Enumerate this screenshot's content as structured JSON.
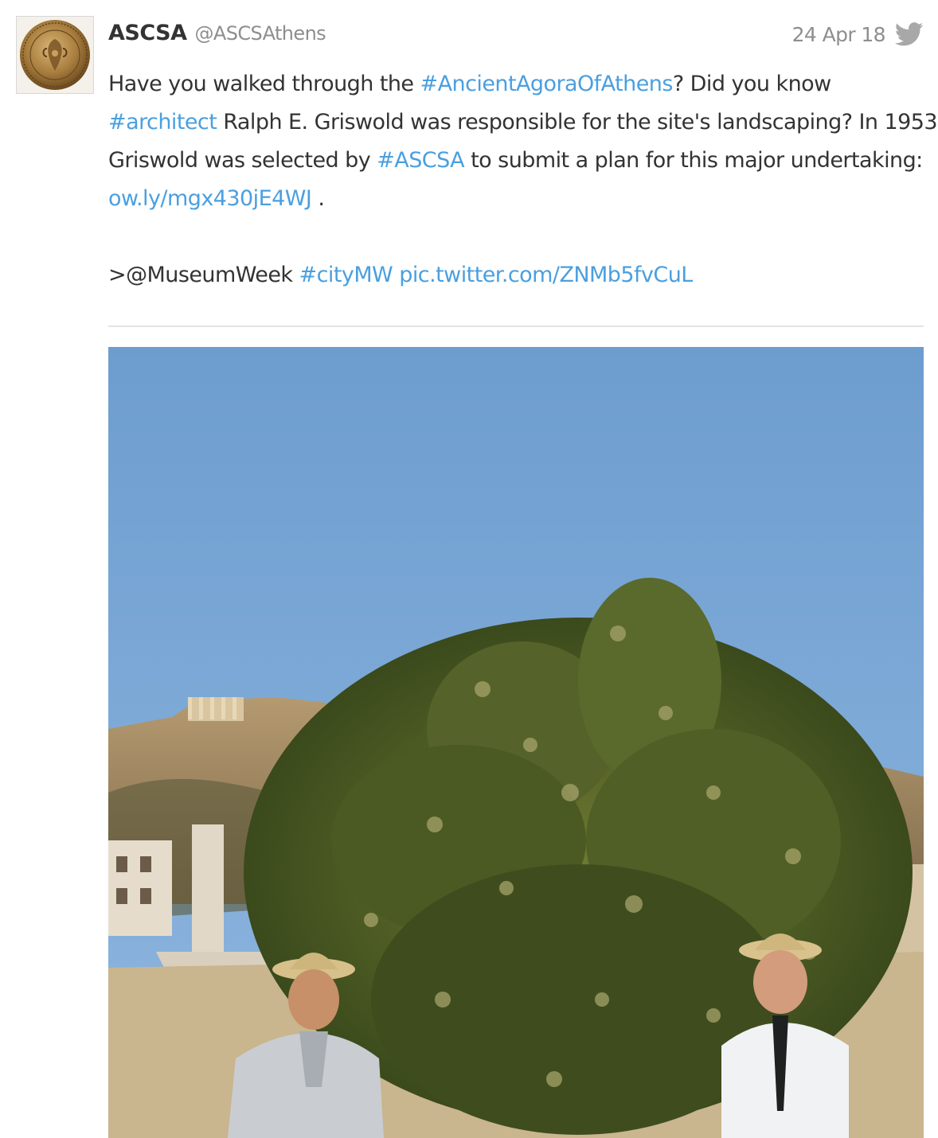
{
  "account": {
    "display_name": "ASCSA",
    "handle": "@ASCSAthens",
    "avatar_icon": "bronze-seal-avatar"
  },
  "meta": {
    "timestamp": "24 Apr 18",
    "platform_icon": "twitter-bird-icon"
  },
  "tweet": {
    "line1": {
      "t1": "Have you walked through the ",
      "h1": "#AncientAgoraOfAthens",
      "t2": "? Did you know"
    },
    "line2": {
      "h1": "#architect",
      "t1": " Ralph E. Griswold was responsible for the site's landscaping? In 1953,"
    },
    "line3": {
      "t1": "Griswold was selected by ",
      "h1": "#ASCSA",
      "t2": " to submit a plan for this major undertaking:"
    },
    "line4": {
      "l1": "ow.ly/mgx430jE4WJ",
      "t1": " ."
    },
    "line5": {
      "t1": ">@MuseumWeek ",
      "h1": "#cityMW",
      "t2": " ",
      "l1": "pic.twitter.com/ZNMb5fvCuL"
    }
  },
  "colors": {
    "link": "#4a9fe0",
    "text": "#333333",
    "muted": "#8e8e8e",
    "sky": "#7aa7d6"
  },
  "media": {
    "type": "photo",
    "scene": "acropolis-with-tree-and-two-men"
  }
}
